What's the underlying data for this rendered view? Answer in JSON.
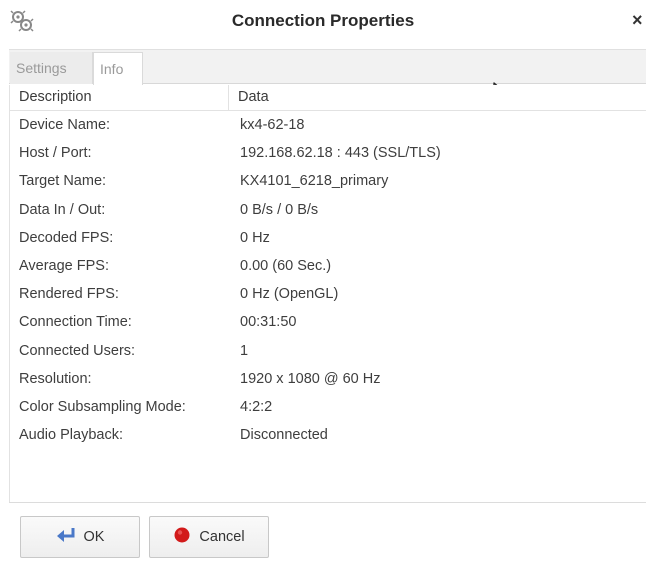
{
  "window": {
    "title": "Connection Properties",
    "close_glyph": "×",
    "app_icon": "gear-cluster-icon"
  },
  "tabs": [
    {
      "label": "Settings",
      "active": false
    },
    {
      "label": "Info",
      "active": true
    }
  ],
  "table": {
    "headers": {
      "description": "Description",
      "data": "Data"
    },
    "rows": [
      {
        "description": "Device Name:",
        "data": "kx4-62-18"
      },
      {
        "description": "Host / Port:",
        "data": "192.168.62.18 : 443 (SSL/TLS)"
      },
      {
        "description": "Target Name:",
        "data": "KX4101_6218_primary"
      },
      {
        "description": "Data In / Out:",
        "data": "0 B/s / 0 B/s"
      },
      {
        "description": "Decoded FPS:",
        "data": "0 Hz"
      },
      {
        "description": "Average FPS:",
        "data": "0.00 (60 Sec.)"
      },
      {
        "description": "Rendered FPS:",
        "data": "0 Hz (OpenGL)"
      },
      {
        "description": "Connection Time:",
        "data": "00:31:50"
      },
      {
        "description": "Connected Users:",
        "data": "1"
      },
      {
        "description": "Resolution:",
        "data": "1920 x 1080 @ 60 Hz"
      },
      {
        "description": "Color Subsampling Mode:",
        "data": "4:2:2"
      },
      {
        "description": "Audio Playback:",
        "data": "Disconnected"
      }
    ]
  },
  "buttons": {
    "ok_label": "OK",
    "cancel_label": "Cancel",
    "ok_icon": "enter-arrow-icon",
    "cancel_icon": "red-dot-icon"
  },
  "colors": {
    "ok_icon": "#4a78c8",
    "cancel_icon": "#d21a1a"
  }
}
